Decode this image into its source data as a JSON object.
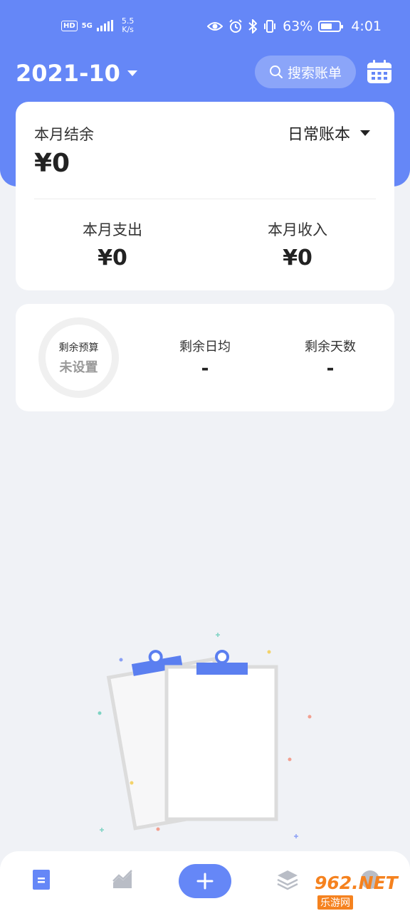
{
  "status_bar": {
    "network": "5G",
    "hd_label": "HD",
    "speed_value": "5.5",
    "speed_unit": "K/s",
    "battery": "63%",
    "battery_level": 0.63,
    "time": "4:01"
  },
  "header": {
    "month": "2021-10",
    "search_placeholder": "搜索账单"
  },
  "summary": {
    "balance_label": "本月结余",
    "balance_value": "¥0",
    "book_name": "日常账本",
    "expense_label": "本月支出",
    "expense_value": "¥0",
    "income_label": "本月收入",
    "income_value": "¥0"
  },
  "budget": {
    "ring_label": "剩余预算",
    "ring_status": "未设置",
    "daily_label": "剩余日均",
    "daily_value": "-",
    "days_label": "剩余天数",
    "days_value": "-"
  },
  "watermark": {
    "brand": "962.NET",
    "sub": "乐游网"
  },
  "colors": {
    "accent": "#6587f7",
    "background": "#f0f2f6",
    "card": "#ffffff"
  }
}
